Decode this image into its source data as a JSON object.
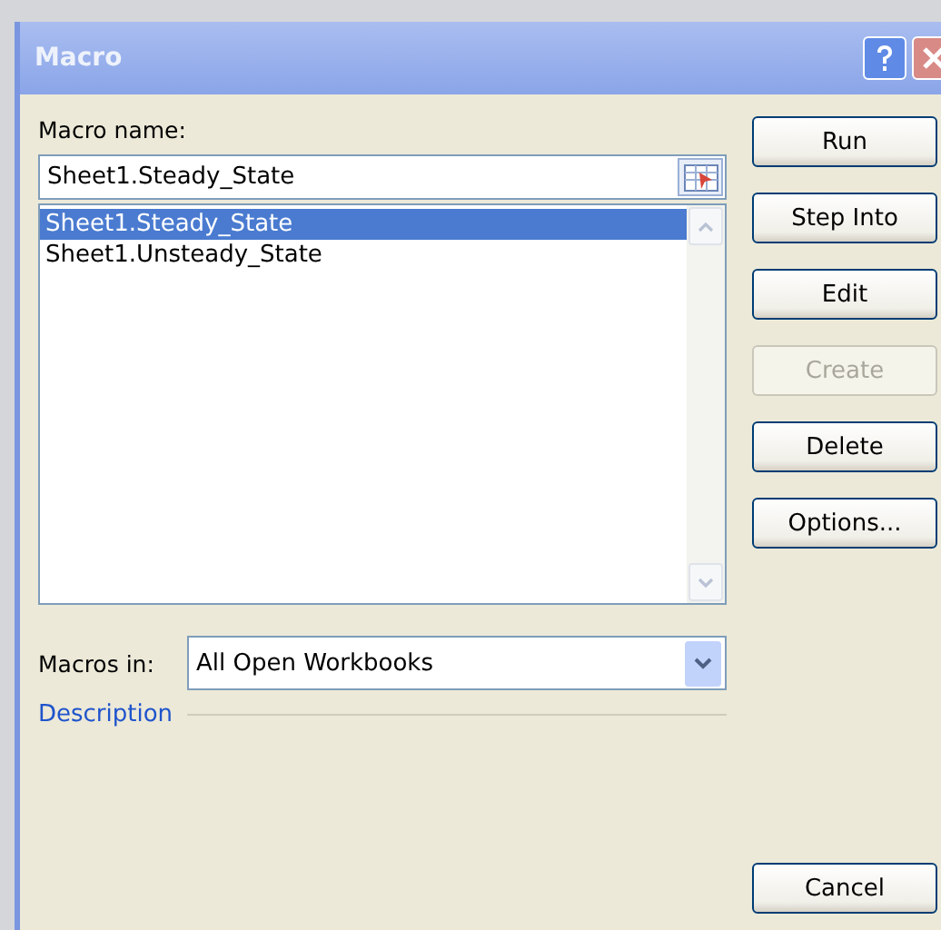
{
  "window": {
    "title": "Macro"
  },
  "macro_name": {
    "label": "Macro name:",
    "value": "Sheet1.Steady_State"
  },
  "macros": [
    {
      "name": "Sheet1.Steady_State",
      "selected": true
    },
    {
      "name": "Sheet1.Unsteady_State",
      "selected": false
    }
  ],
  "macros_in": {
    "label": "Macros in:",
    "value": "All Open Workbooks"
  },
  "description": {
    "label": "Description"
  },
  "buttons": [
    {
      "label": "Run",
      "disabled": false
    },
    {
      "label": "Step Into",
      "disabled": false
    },
    {
      "label": "Edit",
      "disabled": false
    },
    {
      "label": "Create",
      "disabled": true
    },
    {
      "label": "Delete",
      "disabled": false
    },
    {
      "label": "Options...",
      "disabled": false
    }
  ],
  "cancel_button": {
    "label": "Cancel"
  }
}
